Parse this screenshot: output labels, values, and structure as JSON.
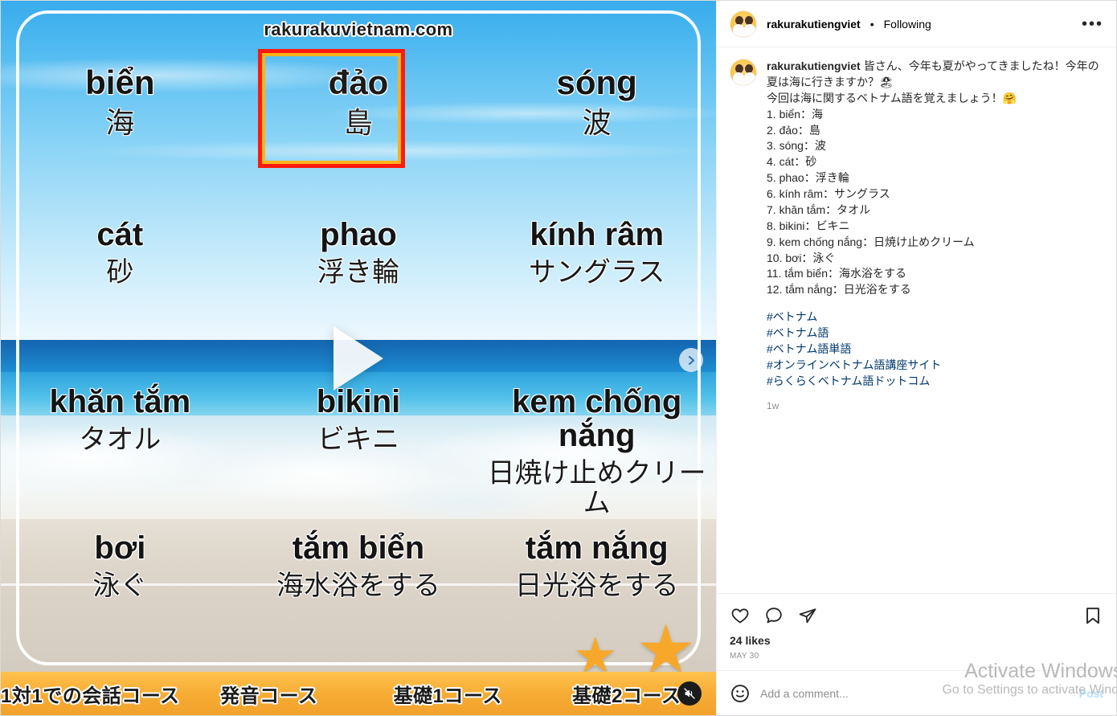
{
  "header": {
    "username": "rakurakutiengviet",
    "separator": "•",
    "following_label": "Following",
    "more_icon": "•••"
  },
  "caption": {
    "username": "rakurakutiengviet",
    "intro_line_1": "皆さん、今年も夏がやってきましたね！今年の夏は海に行きますか？🏖",
    "intro_line_2": "今回は海に関するベトナム語を覚えましょう！🤗",
    "vocab": [
      "1. biển：海",
      "2. đảo：島",
      "3. sóng：波",
      "4. cát：砂",
      "5. phao：浮き輪",
      "6. kính râm：サングラス",
      "7. khăn tắm：タオル",
      "8. bikini：ビキニ",
      "9. kem chống nắng：日焼け止めクリーム",
      "10. bơi：泳ぐ",
      "11. tắm biển：海水浴をする",
      "12. tắm nắng：日光浴をする"
    ],
    "hashtags": [
      "#ベトナム",
      "#ベトナム語",
      "#ベトナム語単語",
      "#オンラインベトナム語講座サイト",
      "#らくらくベトナム語ドットコム"
    ],
    "time_ago": "1w"
  },
  "actions": {
    "like_icon": "heart-icon",
    "comment_icon": "comment-icon",
    "share_icon": "share-icon",
    "save_icon": "bookmark-icon",
    "likes_text": "24 likes",
    "date_text": "MAY 30"
  },
  "comment_box": {
    "emoji_icon": "emoji-icon",
    "placeholder": "Add a comment...",
    "value": "",
    "post_label": "Post"
  },
  "watermark": {
    "line1": "Activate Windows",
    "line2": "Go to Settings to activate Windows."
  },
  "media": {
    "site_url": "rakurakuvietnam.com",
    "play_icon": "play-icon",
    "next_icon": "chevron-right-icon",
    "mute_icon": "mute-icon",
    "highlight_color_outer": "#ff1a0d",
    "highlight_color_inner": "#ffb31a",
    "rows": [
      [
        {
          "vi": "biển",
          "ja": "海"
        },
        {
          "vi": "đảo",
          "ja": "島"
        },
        {
          "vi": "sóng",
          "ja": "波"
        }
      ],
      [
        {
          "vi": "cát",
          "ja": "砂"
        },
        {
          "vi": "phao",
          "ja": "浮き輪"
        },
        {
          "vi": "kính râm",
          "ja": "サングラス"
        }
      ],
      [
        {
          "vi": "khăn tắm",
          "ja": "タオル"
        },
        {
          "vi": "bikini",
          "ja": "ビキニ"
        },
        {
          "vi": "kem chống nắng",
          "ja": "日焼け止めクリーム"
        }
      ],
      [
        {
          "vi": "bơi",
          "ja": "泳ぐ"
        },
        {
          "vi": "tắm biển",
          "ja": "海水浴をする"
        },
        {
          "vi": "tắm nắng",
          "ja": "日光浴をする"
        }
      ]
    ],
    "banner": [
      "1対1での会話コース",
      "発音コース",
      "基礎1コース",
      "基礎2コース"
    ]
  }
}
